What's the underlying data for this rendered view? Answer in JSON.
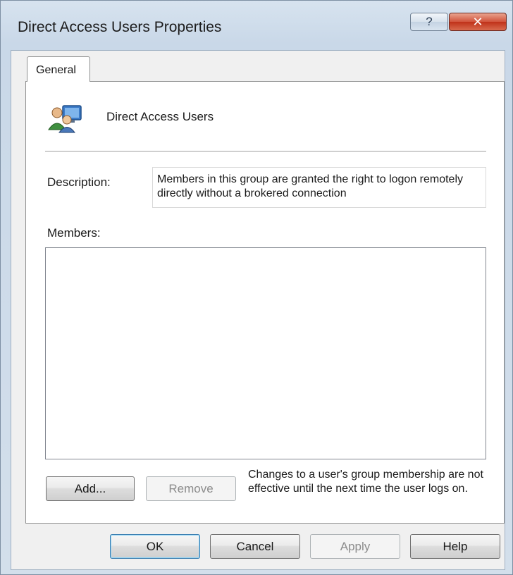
{
  "window": {
    "title": "Direct Access Users Properties",
    "help_glyph": "?",
    "close_glyph": "✕"
  },
  "tabs": [
    {
      "label": "General",
      "selected": true
    }
  ],
  "general": {
    "group_icon": "users-group-icon",
    "group_name": "Direct Access Users",
    "description_label": "Description:",
    "description_value": "Members in this group are granted the right to logon remotely directly without a brokered connection",
    "members_label": "Members:",
    "members": [],
    "add_button": "Add...",
    "remove_button": "Remove",
    "note": "Changes to a user's group membership are not effective until the next time the user logs on."
  },
  "footer": {
    "ok": "OK",
    "cancel": "Cancel",
    "apply": "Apply",
    "help": "Help"
  },
  "colors": {
    "close_button": "#c0321a",
    "default_button_border": "#3c7fb1"
  }
}
